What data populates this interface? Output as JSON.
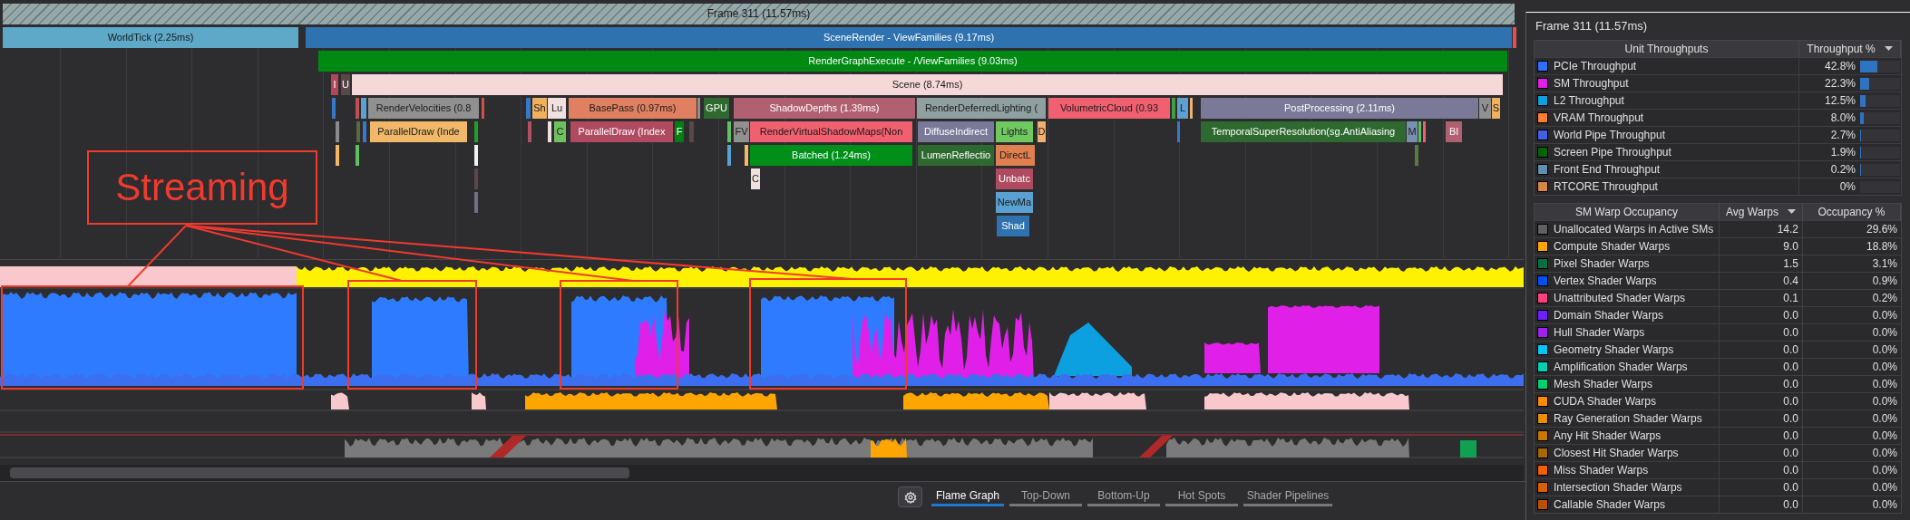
{
  "flame_graph": {
    "levels": [
      {
        "bars": [
          {
            "label": "Frame 311 (11.57ms)",
            "kind": "frame"
          }
        ]
      },
      {
        "bars": [
          {
            "label": "WorldTick (2.25ms)",
            "color": "#5ea8c8"
          },
          {
            "label": "SceneRender - ViewFamilies (9.17ms)",
            "color": "#2e72b0"
          },
          {
            "color": "#e05050"
          }
        ]
      },
      {
        "bars": [
          {
            "label": "RenderGraphExecute - /ViewFamilies (9.03ms)",
            "color": "#008a14"
          }
        ]
      },
      {
        "bars": [
          {
            "label": "I",
            "color": "#b04858"
          },
          {
            "label": "U",
            "color": "#5a4848"
          },
          {
            "label": "Scene (8.74ms)",
            "color": "#f5d8d8"
          }
        ]
      },
      {
        "bars": [
          {
            "color": "#3878c8"
          },
          {
            "color": "#c05050"
          },
          {
            "color": "#5aa0d0"
          },
          {
            "label": "RenderVelocities (0.8",
            "color": "#909090"
          },
          {
            "color": "#d05050"
          },
          {
            "color": "#3878c8"
          },
          {
            "label": "Sh",
            "color": "#f0b060"
          },
          {
            "label": "Lu",
            "color": "#f0e0e0"
          },
          {
            "label": "BasePass (0.97ms)",
            "color": "#e08060"
          },
          {
            "color": "#909090"
          },
          {
            "label": "GPU",
            "color": "#306830"
          },
          {
            "label": "ShadowDepths (1.39ms)",
            "color": "#b06070"
          },
          {
            "label": "RenderDeferredLighting (",
            "color": "#90a0a0"
          },
          {
            "label": "VolumetricCloud (0.93",
            "color": "#f06070"
          },
          {
            "color": "#40a040"
          },
          {
            "label": "L",
            "color": "#60a0d0"
          },
          {
            "color": "#f0b070"
          },
          {
            "label": "PostProcessing (2.11ms)",
            "color": "#7a7a98"
          },
          {
            "label": "V",
            "color": "#909090"
          },
          {
            "label": "S",
            "color": "#f0b060"
          }
        ]
      },
      {
        "bars": [
          {
            "color": "#8a8a8a"
          },
          {
            "color": "#5a6a3a"
          },
          {
            "color": "#3878c8"
          },
          {
            "label": "ParallelDraw (Inde",
            "color": "#f0b868"
          },
          {
            "color": "#20a020"
          },
          {
            "color": "#b05060"
          },
          {
            "color": "#f0e0e0"
          },
          {
            "label": "C",
            "color": "#70c060"
          },
          {
            "label": "ParallelDraw (Index",
            "color": "#b04a60"
          },
          {
            "label": "F",
            "color": "#008010"
          },
          {
            "color": "#5a4848"
          },
          {
            "color": "#60c060"
          },
          {
            "label": "FV",
            "color": "#909090"
          },
          {
            "label": "RenderVirtualShadowMaps(Non",
            "color": "#f06070"
          },
          {
            "label": "DiffuseIndirect",
            "color": "#7a7a98"
          },
          {
            "label": "Lights",
            "color": "#70c860"
          },
          {
            "label": "D",
            "color": "#f0b070"
          },
          {
            "color": "#3878c8"
          },
          {
            "label": "TemporalSuperResolution(sg.AntiAliasing",
            "color": "#2e6a30"
          },
          {
            "label": "M",
            "color": "#7a90b0"
          },
          {
            "color": "#60c060"
          },
          {
            "color": "#f06070"
          },
          {
            "label": "Bl",
            "color": "#b06070"
          }
        ]
      },
      {
        "bars": [
          {
            "color": "#f0b868"
          },
          {
            "color": "#60c060"
          },
          {
            "color": "#f0f0f0"
          },
          {
            "color": "#5aa0d0"
          },
          {
            "color": "#f0b868"
          },
          {
            "label": "Batched (1.24ms)",
            "color": "#00901a"
          },
          {
            "label": "LumenReflectio",
            "color": "#2e6a30"
          },
          {
            "label": "DirectL",
            "color": "#e08050"
          },
          {
            "color": "#5a7a40"
          }
        ]
      },
      {
        "bars": [
          {
            "color": "#5a4848"
          },
          {
            "label": "C",
            "color": "#f0e0e0"
          },
          {
            "label": "Unbatc",
            "color": "#b04a60"
          }
        ]
      },
      {
        "bars": [
          {
            "color": "#707080"
          },
          {
            "label": "NewMa",
            "color": "#5aa0d0"
          }
        ]
      },
      {
        "bars": [
          {
            "label": "Shad",
            "color": "#2e72b0"
          }
        ]
      }
    ]
  },
  "annotation": {
    "label": "Streaming"
  },
  "bottom_tabs": [
    {
      "label": "Flame Graph",
      "selected": true
    },
    {
      "label": "Top-Down",
      "selected": false
    },
    {
      "label": "Bottom-Up",
      "selected": false
    },
    {
      "label": "Hot Spots",
      "selected": false
    },
    {
      "label": "Shader Pipelines",
      "selected": false
    }
  ],
  "side_panel": {
    "title": "Frame 311 (11.57ms)",
    "throughput_table": {
      "columns": [
        "Unit Throughputs",
        "Throughput %"
      ],
      "rows": [
        {
          "name": "PCIe Throughput",
          "color": "#2f6fff",
          "value": "42.8%",
          "level": 0.428
        },
        {
          "name": "SM Throughput",
          "color": "#e020e8",
          "value": "22.3%",
          "level": 0.223
        },
        {
          "name": "L2 Throughput",
          "color": "#0ca0e0",
          "value": "12.5%",
          "level": 0.125
        },
        {
          "name": "VRAM Throughput",
          "color": "#ff7f30",
          "value": "8.0%",
          "level": 0.08
        },
        {
          "name": "World Pipe Throughput",
          "color": "#4060e8",
          "value": "2.7%",
          "level": 0.027
        },
        {
          "name": "Screen Pipe Throughput",
          "color": "#006400",
          "value": "1.9%",
          "level": 0.019
        },
        {
          "name": "Front End Throughput",
          "color": "#6090b0",
          "value": "0.2%",
          "level": 0.002
        },
        {
          "name": "RTCORE Throughput",
          "color": "#d88840",
          "value": "0%",
          "level": 0
        }
      ]
    },
    "occupancy_table": {
      "columns": [
        "SM Warp Occupancy",
        "Avg Warps",
        "Occupancy %"
      ],
      "rows": [
        {
          "name": "Unallocated Warps in Active SMs",
          "color": "#606060",
          "avg_warps": "14.2",
          "occupancy": "29.6%"
        },
        {
          "name": "Compute Shader Warps",
          "color": "#ffa500",
          "avg_warps": "9.0",
          "occupancy": "18.8%"
        },
        {
          "name": "Pixel Shader Warps",
          "color": "#007040",
          "avg_warps": "1.5",
          "occupancy": "3.1%"
        },
        {
          "name": "Vertex Shader Warps",
          "color": "#0050f0",
          "avg_warps": "0.4",
          "occupancy": "0.9%"
        },
        {
          "name": "Unattributed Shader Warps",
          "color": "#ff4080",
          "avg_warps": "0.1",
          "occupancy": "0.2%"
        },
        {
          "name": "Domain Shader Warps",
          "color": "#7020ff",
          "avg_warps": "0.0",
          "occupancy": "0.0%"
        },
        {
          "name": "Hull Shader Warps",
          "color": "#a020f0",
          "avg_warps": "0.0",
          "occupancy": "0.0%"
        },
        {
          "name": "Geometry Shader Warps",
          "color": "#00c8ff",
          "avg_warps": "0.0",
          "occupancy": "0.0%"
        },
        {
          "name": "Amplification Shader Warps",
          "color": "#00d0b0",
          "avg_warps": "0.0",
          "occupancy": "0.0%"
        },
        {
          "name": "Mesh Shader Warps",
          "color": "#00d070",
          "avg_warps": "0.0",
          "occupancy": "0.0%"
        },
        {
          "name": "CUDA Shader Warps",
          "color": "#ff8c00",
          "avg_warps": "0.0",
          "occupancy": "0.0%"
        },
        {
          "name": "Ray Generation Shader Warps",
          "color": "#e89000",
          "avg_warps": "0.0",
          "occupancy": "0.0%"
        },
        {
          "name": "Any Hit Shader Warps",
          "color": "#c87800",
          "avg_warps": "0.0",
          "occupancy": "0.0%"
        },
        {
          "name": "Closest Hit Shader Warps",
          "color": "#a86800",
          "avg_warps": "0.0",
          "occupancy": "0.0%"
        },
        {
          "name": "Miss Shader Warps",
          "color": "#f06000",
          "avg_warps": "0.0",
          "occupancy": "0.0%"
        },
        {
          "name": "Intersection Shader Warps",
          "color": "#d86000",
          "avg_warps": "0.0",
          "occupancy": "0.0%"
        },
        {
          "name": "Callable Shader Warps",
          "color": "#b85000",
          "avg_warps": "0.0",
          "occupancy": "0.0%"
        }
      ]
    }
  }
}
